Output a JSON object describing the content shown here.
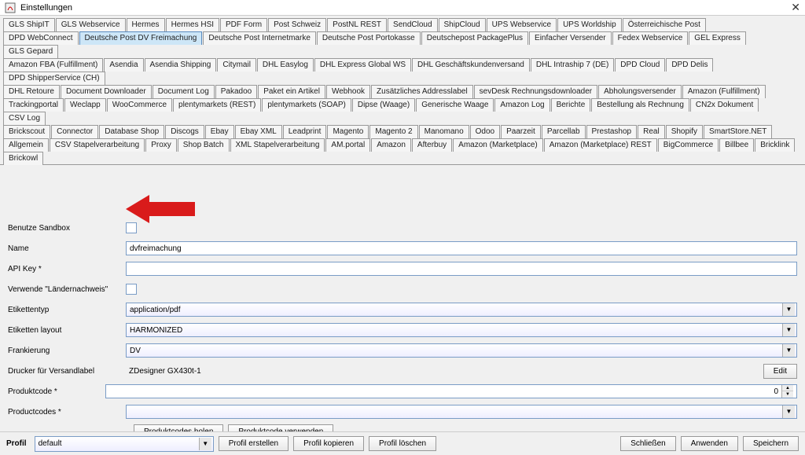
{
  "window": {
    "title": "Einstellungen"
  },
  "tabs": [
    [
      "GLS ShipIT",
      "GLS Webservice",
      "Hermes",
      "Hermes HSI",
      "PDF Form",
      "Post Schweiz",
      "PostNL REST",
      "SendCloud",
      "ShipCloud",
      "UPS Webservice",
      "UPS Worldship",
      "Österreichische Post"
    ],
    [
      "DPD WebConnect",
      "Deutsche Post DV Freimachung",
      "Deutsche Post Internetmarke",
      "Deutsche Post Portokasse",
      "Deutschepost PackagePlus",
      "Einfacher Versender",
      "Fedex Webservice",
      "GEL Express",
      "GLS Gepard"
    ],
    [
      "Amazon FBA (Fulfillment)",
      "Asendia",
      "Asendia Shipping",
      "Citymail",
      "DHL Easylog",
      "DHL Express Global WS",
      "DHL Geschäftskundenversand",
      "DHL Intraship 7 (DE)",
      "DPD Cloud",
      "DPD Delis",
      "DPD ShipperService (CH)"
    ],
    [
      "DHL Retoure",
      "Document Downloader",
      "Document Log",
      "Pakadoo",
      "Paket ein Artikel",
      "Webhook",
      "Zusätzliches Addresslabel",
      "sevDesk Rechnungsdownloader",
      "Abholungsversender",
      "Amazon (Fulfillment)"
    ],
    [
      "Trackingportal",
      "Weclapp",
      "WooCommerce",
      "plentymarkets (REST)",
      "plentymarkets (SOAP)",
      "Dipse (Waage)",
      "Generische Waage",
      "Amazon Log",
      "Berichte",
      "Bestellung als Rechnung",
      "CN2x Dokument",
      "CSV Log"
    ],
    [
      "Brickscout",
      "Connector",
      "Database Shop",
      "Discogs",
      "Ebay",
      "Ebay XML",
      "Leadprint",
      "Magento",
      "Magento 2",
      "Manomano",
      "Odoo",
      "Paarzeit",
      "Parcellab",
      "Prestashop",
      "Real",
      "Shopify",
      "SmartStore.NET"
    ],
    [
      "Allgemein",
      "CSV Stapelverarbeitung",
      "Proxy",
      "Shop Batch",
      "XML Stapelverarbeitung",
      "AM.portal",
      "Amazon",
      "Afterbuy",
      "Amazon (Marketplace)",
      "Amazon (Marketplace) REST",
      "BigCommerce",
      "Billbee",
      "Bricklink",
      "Brickowl"
    ]
  ],
  "activeTab": "Deutsche Post DV Freimachung",
  "form": {
    "sandbox": {
      "label": "Benutze Sandbox"
    },
    "name": {
      "label": "Name",
      "value": "dvfreimachung"
    },
    "apikey": {
      "label": "API Key *",
      "value": ""
    },
    "laender": {
      "label": "Verwende \"Ländernachweis\""
    },
    "etiketttyp": {
      "label": "Etikettentyp",
      "value": "application/pdf"
    },
    "layout": {
      "label": "Etiketten layout",
      "value": "HARMONIZED"
    },
    "frank": {
      "label": "Frankierung",
      "value": "DV"
    },
    "printer": {
      "label": "Drucker für Versandlabel",
      "value": "ZDesigner GX430t-1",
      "edit": "Edit"
    },
    "prodcode": {
      "label": "Produktcode *",
      "value": "0"
    },
    "prodcodes": {
      "label": "Productcodes *",
      "value": ""
    },
    "btn_holen": "Produktcodes holen",
    "btn_verwenden": "Produktcode verwenden"
  },
  "footer": {
    "profile_label": "Profil",
    "profile_value": "default",
    "btn_erstellen": "Profil erstellen",
    "btn_kopieren": "Profil kopieren",
    "btn_loeschen": "Profil löschen",
    "btn_schliessen": "Schließen",
    "btn_anwenden": "Anwenden",
    "btn_speichern": "Speichern"
  }
}
